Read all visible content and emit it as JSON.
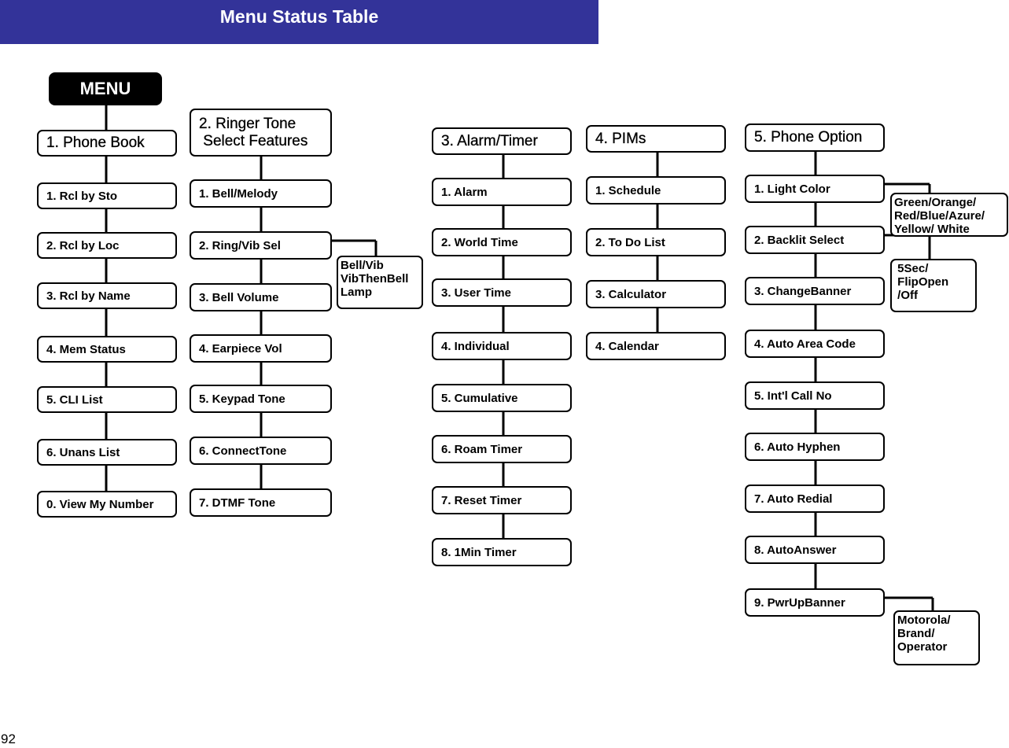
{
  "header": {
    "title": "Menu Status Table",
    "color": "#333399"
  },
  "page_number": "92",
  "diagram": {
    "root": "MENU",
    "columns": [
      {
        "id": "phone-book",
        "title": "1. Phone  Book",
        "items": [
          "1. Rcl by Sto",
          "2. Rcl by Loc",
          "3. Rcl  by Name",
          "4. Mem Status",
          "5. CLI List",
          "6. Unans List",
          "0. View My Number"
        ]
      },
      {
        "id": "ringer-tone",
        "title": "2. Ringer Tone\n Select Features",
        "items": [
          "1. Bell/Melody",
          "2. Ring/Vib Sel",
          "3. Bell Volume",
          "4. Earpiece Vol",
          "5. Keypad Tone",
          "6. ConnectTone",
          "7. DTMF Tone"
        ],
        "options": [
          {
            "for_item": 1,
            "text": "Bell/Vib\nVibThenBell\nLamp"
          }
        ]
      },
      {
        "id": "alarm-timer",
        "title": "3. Alarm/Timer",
        "items": [
          "1. Alarm",
          "2. World Time",
          "3. User Time",
          "4. Individual",
          "5. Cumulative",
          "6. Roam Timer",
          "7. Reset Timer",
          "8. 1Min Timer"
        ]
      },
      {
        "id": "pims",
        "title": "4. PIMs",
        "items": [
          "1. Schedule",
          "2. To Do List",
          "3. Calculator",
          "4. Calendar"
        ]
      },
      {
        "id": "phone-option",
        "title": "5. Phone Option",
        "items": [
          "1. Light Color",
          "2. Backlit Select",
          "3. ChangeBanner",
          "4. Auto Area Code",
          "5. Int'l Call No",
          "6. Auto Hyphen",
          "7. Auto Redial",
          "8. AutoAnswer",
          "9. PwrUpBanner"
        ],
        "options": [
          {
            "for_item": 0,
            "text": "Green/Orange/\nRed/Blue/Azure/\nYellow/ White"
          },
          {
            "for_item": 1,
            "text": " 5Sec/\n FlipOpen\n /Off"
          },
          {
            "for_item": 8,
            "text": "Motorola/\nBrand/\nOperator"
          }
        ]
      }
    ]
  }
}
